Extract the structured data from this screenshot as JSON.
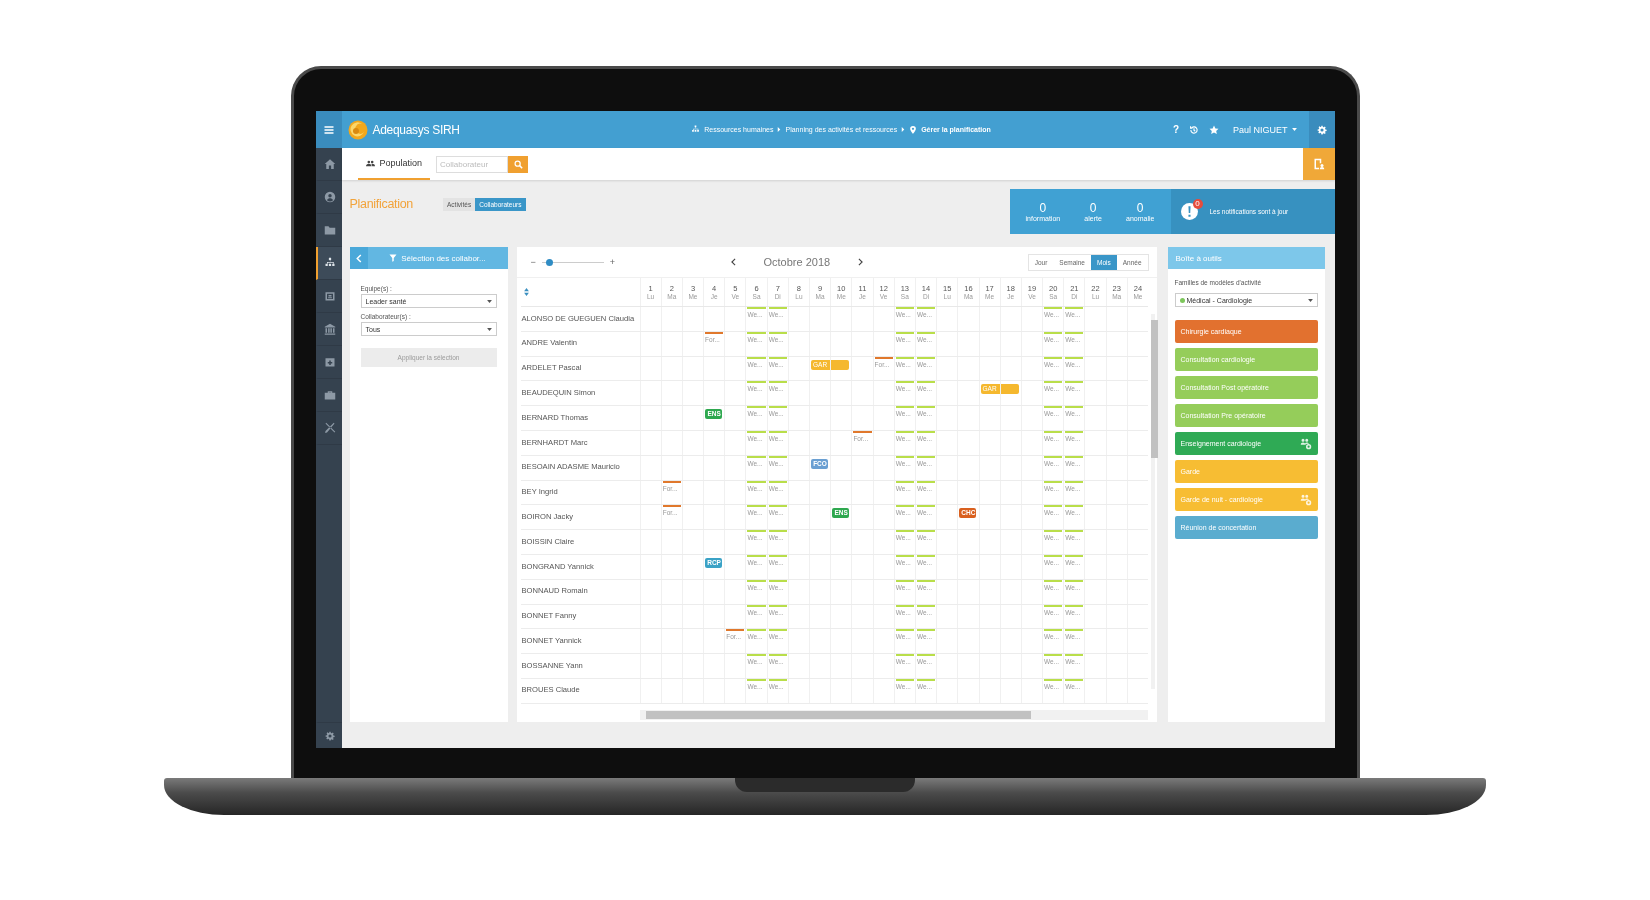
{
  "header": {
    "app_name": "Adequasys SIRH",
    "breadcrumb": [
      {
        "label": "Ressources humaines",
        "current": false
      },
      {
        "label": "Planning des activités et ressources",
        "current": false
      },
      {
        "label": "Gérer la planification",
        "current": true
      }
    ],
    "help": "?",
    "user": "Paul NIGUET"
  },
  "sidebar": {
    "items": [
      {
        "selected": false
      },
      {
        "selected": false
      },
      {
        "selected": false
      },
      {
        "selected": true
      },
      {
        "selected": false
      },
      {
        "selected": false
      },
      {
        "selected": false
      },
      {
        "selected": false
      },
      {
        "selected": false
      }
    ]
  },
  "toolbar": {
    "tabs": [
      {
        "label": "Population",
        "selected": true
      }
    ],
    "search": {
      "placeholder": "Collaborateur"
    }
  },
  "planning": {
    "title": "Planification",
    "modes": [
      {
        "label": "Activités",
        "selected": false
      },
      {
        "label": "Collaborateurs",
        "selected": true
      }
    ]
  },
  "stats": [
    {
      "value": "0",
      "label": "information"
    },
    {
      "value": "0",
      "label": "alerte"
    },
    {
      "value": "0",
      "label": "anomalie"
    }
  ],
  "notifications": {
    "count": "0",
    "message": "Les notifications sont à jour"
  },
  "filter_panel": {
    "title": "Sélection des collabor...",
    "fields": [
      {
        "label": "Equipe(s) :",
        "value": "Leader santé"
      },
      {
        "label": "Collaborateur(s) :",
        "value": "Tous"
      }
    ],
    "apply_button": {
      "label": "Appliquer la sélection",
      "disabled": true
    }
  },
  "calendar": {
    "zoom": {
      "minus": "−",
      "plus": "+",
      "level": 0.12
    },
    "month": "Octobre 2018",
    "views": [
      {
        "label": "Jour",
        "selected": false
      },
      {
        "label": "Semaine",
        "selected": false
      },
      {
        "label": "Mois",
        "selected": true
      },
      {
        "label": "Année",
        "selected": false
      }
    ],
    "days": [
      {
        "number": "1",
        "weekday": "Lu"
      },
      {
        "number": "2",
        "weekday": "Ma"
      },
      {
        "number": "3",
        "weekday": "Me"
      },
      {
        "number": "4",
        "weekday": "Je"
      },
      {
        "number": "5",
        "weekday": "Ve"
      },
      {
        "number": "6",
        "weekday": "Sa"
      },
      {
        "number": "7",
        "weekday": "Di"
      },
      {
        "number": "8",
        "weekday": "Lu"
      },
      {
        "number": "9",
        "weekday": "Ma"
      },
      {
        "number": "10",
        "weekday": "Me"
      },
      {
        "number": "11",
        "weekday": "Je"
      },
      {
        "number": "12",
        "weekday": "Ve"
      },
      {
        "number": "13",
        "weekday": "Sa"
      },
      {
        "number": "14",
        "weekday": "Di"
      },
      {
        "number": "15",
        "weekday": "Lu"
      },
      {
        "number": "16",
        "weekday": "Ma"
      },
      {
        "number": "17",
        "weekday": "Me"
      },
      {
        "number": "18",
        "weekday": "Je"
      },
      {
        "number": "19",
        "weekday": "Ve"
      },
      {
        "number": "20",
        "weekday": "Sa"
      },
      {
        "number": "21",
        "weekday": "Di"
      },
      {
        "number": "22",
        "weekday": "Lu"
      },
      {
        "number": "23",
        "weekday": "Ma"
      },
      {
        "number": "24",
        "weekday": "Me"
      }
    ],
    "rows": [
      {
        "name": "ALONSO DE GUEGUEN Claudia",
        "cells": [
          null,
          null,
          null,
          null,
          null,
          {
            "kind": "weekend",
            "label": "We..."
          },
          {
            "kind": "weekend",
            "label": "We..."
          },
          null,
          null,
          null,
          null,
          null,
          {
            "kind": "weekend",
            "label": "We..."
          },
          {
            "kind": "weekend",
            "label": "We..."
          },
          null,
          null,
          null,
          null,
          null,
          {
            "kind": "weekend",
            "label": "We..."
          },
          {
            "kind": "weekend",
            "label": "We..."
          },
          null,
          null,
          null
        ]
      },
      {
        "name": "ANDRE Valentin",
        "cells": [
          null,
          null,
          null,
          {
            "kind": "training",
            "label": "For..."
          },
          null,
          {
            "kind": "weekend",
            "label": "We..."
          },
          {
            "kind": "weekend",
            "label": "We..."
          },
          null,
          null,
          null,
          null,
          null,
          {
            "kind": "weekend",
            "label": "We..."
          },
          {
            "kind": "weekend",
            "label": "We..."
          },
          null,
          null,
          null,
          null,
          null,
          {
            "kind": "weekend",
            "label": "We..."
          },
          {
            "kind": "weekend",
            "label": "We..."
          },
          null,
          null,
          null
        ]
      },
      {
        "name": "ARDELET Pascal",
        "cells": [
          null,
          null,
          null,
          null,
          null,
          {
            "kind": "weekend",
            "label": "We..."
          },
          {
            "kind": "weekend",
            "label": "We..."
          },
          null,
          {
            "kind": "badge",
            "label": "GAR",
            "color": "#f5b82e",
            "wide": true
          },
          null,
          null,
          {
            "kind": "training",
            "label": "For..."
          },
          {
            "kind": "weekend",
            "label": "We..."
          },
          {
            "kind": "weekend",
            "label": "We..."
          },
          null,
          null,
          null,
          null,
          null,
          {
            "kind": "weekend",
            "label": "We..."
          },
          {
            "kind": "weekend",
            "label": "We..."
          },
          null,
          null,
          null
        ]
      },
      {
        "name": "BEAUDEQUIN Simon",
        "cells": [
          null,
          null,
          null,
          null,
          null,
          {
            "kind": "weekend",
            "label": "We..."
          },
          {
            "kind": "weekend",
            "label": "We..."
          },
          null,
          null,
          null,
          null,
          null,
          {
            "kind": "weekend",
            "label": "We..."
          },
          {
            "kind": "weekend",
            "label": "We..."
          },
          null,
          null,
          {
            "kind": "badge",
            "label": "GAR",
            "color": "#f5b82e",
            "wide": true
          },
          null,
          null,
          {
            "kind": "weekend",
            "label": "We..."
          },
          {
            "kind": "weekend",
            "label": "We..."
          },
          null,
          null,
          null
        ]
      },
      {
        "name": "BERNARD Thomas",
        "cells": [
          null,
          null,
          null,
          {
            "kind": "badge",
            "label": "ENS",
            "color": "#2ea84f",
            "wide": false
          },
          null,
          {
            "kind": "weekend",
            "label": "We..."
          },
          {
            "kind": "weekend",
            "label": "We..."
          },
          null,
          null,
          null,
          null,
          null,
          {
            "kind": "weekend",
            "label": "We..."
          },
          {
            "kind": "weekend",
            "label": "We..."
          },
          null,
          null,
          null,
          null,
          null,
          {
            "kind": "weekend",
            "label": "We..."
          },
          {
            "kind": "weekend",
            "label": "We..."
          },
          null,
          null,
          null
        ]
      },
      {
        "name": "BERNHARDT Marc",
        "cells": [
          null,
          null,
          null,
          null,
          null,
          {
            "kind": "weekend",
            "label": "We..."
          },
          {
            "kind": "weekend",
            "label": "We..."
          },
          null,
          null,
          null,
          {
            "kind": "training",
            "label": "For..."
          },
          null,
          {
            "kind": "weekend",
            "label": "We..."
          },
          {
            "kind": "weekend",
            "label": "We..."
          },
          null,
          null,
          null,
          null,
          null,
          {
            "kind": "weekend",
            "label": "We..."
          },
          {
            "kind": "weekend",
            "label": "We..."
          },
          null,
          null,
          null
        ]
      },
      {
        "name": "BESOAIN ADASME Mauricio",
        "cells": [
          null,
          null,
          null,
          null,
          null,
          {
            "kind": "weekend",
            "label": "We..."
          },
          {
            "kind": "weekend",
            "label": "We..."
          },
          null,
          {
            "kind": "badge",
            "label": "FCO",
            "color": "#6a9fd2",
            "wide": false
          },
          null,
          null,
          null,
          {
            "kind": "weekend",
            "label": "We..."
          },
          {
            "kind": "weekend",
            "label": "We..."
          },
          null,
          null,
          null,
          null,
          null,
          {
            "kind": "weekend",
            "label": "We..."
          },
          {
            "kind": "weekend",
            "label": "We..."
          },
          null,
          null,
          null
        ]
      },
      {
        "name": "BEY Ingrid",
        "cells": [
          null,
          {
            "kind": "training",
            "label": "For..."
          },
          null,
          null,
          null,
          {
            "kind": "weekend",
            "label": "We..."
          },
          {
            "kind": "weekend",
            "label": "We..."
          },
          null,
          null,
          null,
          null,
          null,
          {
            "kind": "weekend",
            "label": "We..."
          },
          {
            "kind": "weekend",
            "label": "We..."
          },
          null,
          null,
          null,
          null,
          null,
          {
            "kind": "weekend",
            "label": "We..."
          },
          {
            "kind": "weekend",
            "label": "We..."
          },
          null,
          null,
          null
        ]
      },
      {
        "name": "BOIRON Jacky",
        "cells": [
          null,
          {
            "kind": "training",
            "label": "For..."
          },
          null,
          null,
          null,
          {
            "kind": "weekend",
            "label": "We..."
          },
          {
            "kind": "weekend",
            "label": "We..."
          },
          null,
          null,
          {
            "kind": "badge",
            "label": "ENS",
            "color": "#2ea84f",
            "wide": false
          },
          null,
          null,
          {
            "kind": "weekend",
            "label": "We..."
          },
          {
            "kind": "weekend",
            "label": "We..."
          },
          null,
          {
            "kind": "badge",
            "label": "CHC",
            "color": "#d9601f",
            "wide": false
          },
          null,
          null,
          null,
          {
            "kind": "weekend",
            "label": "We..."
          },
          {
            "kind": "weekend",
            "label": "We..."
          },
          null,
          null,
          null
        ]
      },
      {
        "name": "BOISSIN Claire",
        "cells": [
          null,
          null,
          null,
          null,
          null,
          {
            "kind": "weekend",
            "label": "We..."
          },
          {
            "kind": "weekend",
            "label": "We..."
          },
          null,
          null,
          null,
          null,
          null,
          {
            "kind": "weekend",
            "label": "We..."
          },
          {
            "kind": "weekend",
            "label": "We..."
          },
          null,
          null,
          null,
          null,
          null,
          {
            "kind": "weekend",
            "label": "We..."
          },
          {
            "kind": "weekend",
            "label": "We..."
          },
          null,
          null,
          null
        ]
      },
      {
        "name": "BONGRAND Yannick",
        "cells": [
          null,
          null,
          null,
          {
            "kind": "badge",
            "label": "RCP",
            "color": "#3aa2c6",
            "wide": false
          },
          null,
          {
            "kind": "weekend",
            "label": "We..."
          },
          {
            "kind": "weekend",
            "label": "We..."
          },
          null,
          null,
          null,
          null,
          null,
          {
            "kind": "weekend",
            "label": "We..."
          },
          {
            "kind": "weekend",
            "label": "We..."
          },
          null,
          null,
          null,
          null,
          null,
          {
            "kind": "weekend",
            "label": "We..."
          },
          {
            "kind": "weekend",
            "label": "We..."
          },
          null,
          null,
          null
        ]
      },
      {
        "name": "BONNAUD Romain",
        "cells": [
          null,
          null,
          null,
          null,
          null,
          {
            "kind": "weekend",
            "label": "We..."
          },
          {
            "kind": "weekend",
            "label": "We..."
          },
          null,
          null,
          null,
          null,
          null,
          {
            "kind": "weekend",
            "label": "We..."
          },
          {
            "kind": "weekend",
            "label": "We..."
          },
          null,
          null,
          null,
          null,
          null,
          {
            "kind": "weekend",
            "label": "We..."
          },
          {
            "kind": "weekend",
            "label": "We..."
          },
          null,
          null,
          null
        ]
      },
      {
        "name": "BONNET Fanny",
        "cells": [
          null,
          null,
          null,
          null,
          null,
          {
            "kind": "weekend",
            "label": "We..."
          },
          {
            "kind": "weekend",
            "label": "We..."
          },
          null,
          null,
          null,
          null,
          null,
          {
            "kind": "weekend",
            "label": "We..."
          },
          {
            "kind": "weekend",
            "label": "We..."
          },
          null,
          null,
          null,
          null,
          null,
          {
            "kind": "weekend",
            "label": "We..."
          },
          {
            "kind": "weekend",
            "label": "We..."
          },
          null,
          null,
          null
        ]
      },
      {
        "name": "BONNET Yannick",
        "cells": [
          null,
          null,
          null,
          null,
          {
            "kind": "training",
            "label": "For..."
          },
          {
            "kind": "weekend",
            "label": "We..."
          },
          {
            "kind": "weekend",
            "label": "We..."
          },
          null,
          null,
          null,
          null,
          null,
          {
            "kind": "weekend",
            "label": "We..."
          },
          {
            "kind": "weekend",
            "label": "We..."
          },
          null,
          null,
          null,
          null,
          null,
          {
            "kind": "weekend",
            "label": "We..."
          },
          {
            "kind": "weekend",
            "label": "We..."
          },
          null,
          null,
          null
        ]
      },
      {
        "name": "BOSSANNE Yann",
        "cells": [
          null,
          null,
          null,
          null,
          null,
          {
            "kind": "weekend",
            "label": "We..."
          },
          {
            "kind": "weekend",
            "label": "We..."
          },
          null,
          null,
          null,
          null,
          null,
          {
            "kind": "weekend",
            "label": "We..."
          },
          {
            "kind": "weekend",
            "label": "We..."
          },
          null,
          null,
          null,
          null,
          null,
          {
            "kind": "weekend",
            "label": "We..."
          },
          {
            "kind": "weekend",
            "label": "We..."
          },
          null,
          null,
          null
        ]
      },
      {
        "name": "BROUES Claude",
        "cells": [
          null,
          null,
          null,
          null,
          null,
          {
            "kind": "weekend",
            "label": "We..."
          },
          {
            "kind": "weekend",
            "label": "We..."
          },
          null,
          null,
          null,
          null,
          null,
          {
            "kind": "weekend",
            "label": "We..."
          },
          {
            "kind": "weekend",
            "label": "We..."
          },
          null,
          null,
          null,
          null,
          null,
          {
            "kind": "weekend",
            "label": "We..."
          },
          {
            "kind": "weekend",
            "label": "We..."
          },
          null,
          null,
          null
        ]
      }
    ]
  },
  "toolbox": {
    "title": "Boîte à outils",
    "family_label": "Familles de modèles d'activité",
    "family": {
      "label": "Médical - Cardiologie",
      "color": "#7dc65b"
    },
    "items": [
      {
        "label": "Chirurgie cardiaque",
        "color": "#e2712f",
        "template": false
      },
      {
        "label": "Consultation cardiologie",
        "color": "#95cd5a",
        "template": false
      },
      {
        "label": "Consultation Post opératoire",
        "color": "#95cd5a",
        "template": false
      },
      {
        "label": "Consultation Pre opératoire",
        "color": "#95cd5a",
        "template": false
      },
      {
        "label": "Enseignement cardiologie",
        "color": "#2faa55",
        "template": true
      },
      {
        "label": "Garde",
        "color": "#f7bd33",
        "template": false
      },
      {
        "label": "Garde de nuit - cardiologie",
        "color": "#f7bd33",
        "template": true
      },
      {
        "label": "Réunion de concertation",
        "color": "#5aaccf",
        "template": false
      }
    ]
  }
}
